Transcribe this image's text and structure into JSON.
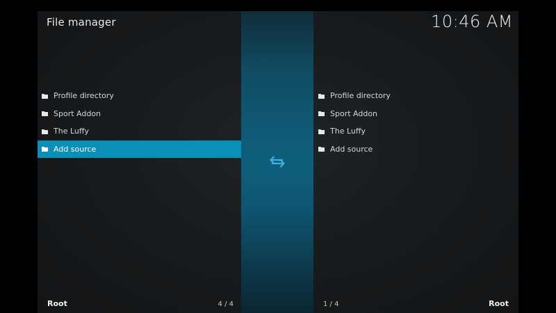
{
  "header": {
    "title": "File manager",
    "clock": "10:46 AM"
  },
  "left_pane": {
    "items": [
      {
        "label": "Profile directory",
        "icon": "folder-icon"
      },
      {
        "label": "Sport Addon",
        "icon": "folder-icon"
      },
      {
        "label": "The Luffy",
        "icon": "folder-icon"
      },
      {
        "label": "Add source",
        "icon": "folder-icon",
        "selected": true
      }
    ],
    "footer_label": "Root",
    "footer_count": "4 / 4"
  },
  "right_pane": {
    "items": [
      {
        "label": "Profile directory",
        "icon": "folder-icon"
      },
      {
        "label": "Sport Addon",
        "icon": "folder-icon"
      },
      {
        "label": "The Luffy",
        "icon": "folder-icon"
      },
      {
        "label": "Add source",
        "icon": "folder-icon"
      }
    ],
    "footer_label": "Root",
    "footer_count": "1 / 4"
  },
  "middle": {
    "icon": "swap-arrows-icon"
  },
  "colors": {
    "accent": "#0a8fb7",
    "swap_icon": "#3fb0dc"
  }
}
